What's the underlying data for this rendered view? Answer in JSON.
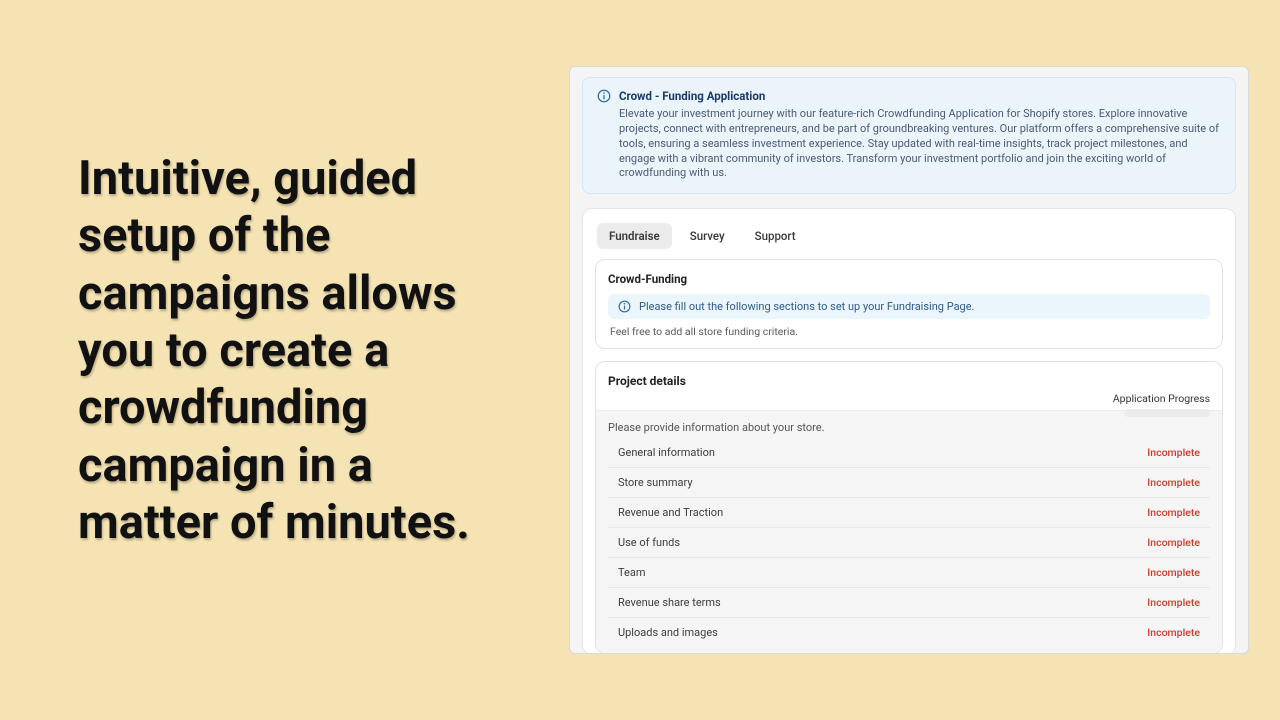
{
  "hero_text": "Intuitive, guided setup of the campaigns allows you to create a crowdfunding campaign in a matter of minutes.",
  "banner": {
    "title": "Crowd - Funding Application",
    "body": "Elevate your investment journey with our feature-rich Crowdfunding Application for Shopify stores. Explore innovative projects, connect with entrepreneurs, and be part of groundbreaking ventures. Our platform offers a comprehensive suite of tools, ensuring a seamless investment experience. Stay updated with real-time insights, track project milestones, and engage with a vibrant community of investors. Transform your investment portfolio and join the exciting world of crowdfunding with us."
  },
  "tabs": [
    "Fundraise",
    "Survey",
    "Support"
  ],
  "crowd_funding": {
    "title": "Crowd-Funding",
    "tip": "Please fill out the following sections to set up your Fundraising Page.",
    "sub": "Feel free to add all store funding criteria."
  },
  "project_details": {
    "title": "Project details",
    "progress_label": "Application Progress",
    "instruction": "Please provide information about your store.",
    "rows": [
      {
        "label": "General information",
        "status": "Incomplete"
      },
      {
        "label": "Store summary",
        "status": "Incomplete"
      },
      {
        "label": "Revenue and Traction",
        "status": "Incomplete"
      },
      {
        "label": "Use of funds",
        "status": "Incomplete"
      },
      {
        "label": "Team",
        "status": "Incomplete"
      },
      {
        "label": "Revenue share terms",
        "status": "Incomplete"
      },
      {
        "label": "Uploads and images",
        "status": "Incomplete"
      }
    ]
  }
}
